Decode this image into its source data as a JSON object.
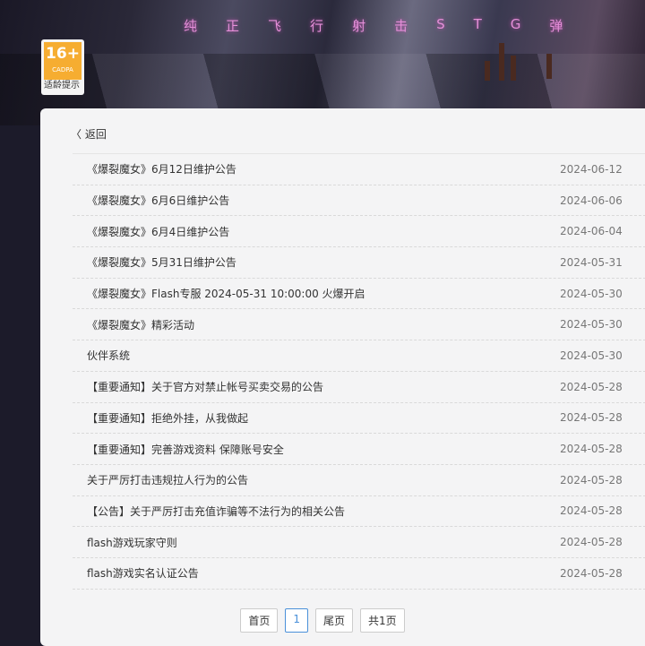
{
  "banner": {
    "slogan": [
      "纯",
      "正",
      "飞",
      "行",
      "射",
      "击",
      "S",
      "T",
      "G",
      "弹"
    ]
  },
  "age_badge": {
    "rating": "16+",
    "org": "CADPA",
    "label": "适龄提示"
  },
  "back_label": "〈 返回",
  "notices": [
    {
      "title": "《爆裂魔女》6月12日维护公告",
      "date": "2024-06-12"
    },
    {
      "title": "《爆裂魔女》6月6日维护公告",
      "date": "2024-06-06"
    },
    {
      "title": "《爆裂魔女》6月4日维护公告",
      "date": "2024-06-04"
    },
    {
      "title": "《爆裂魔女》5月31日维护公告",
      "date": "2024-05-31"
    },
    {
      "title": "《爆裂魔女》Flash专服 2024-05-31 10:00:00 火爆开启",
      "date": "2024-05-30"
    },
    {
      "title": "《爆裂魔女》精彩活动",
      "date": "2024-05-30"
    },
    {
      "title": "伙伴系统",
      "date": "2024-05-30"
    },
    {
      "title": "【重要通知】关于官方对禁止帐号买卖交易的公告",
      "date": "2024-05-28"
    },
    {
      "title": "【重要通知】拒绝外挂，从我做起",
      "date": "2024-05-28"
    },
    {
      "title": "【重要通知】完善游戏资料 保障账号安全",
      "date": "2024-05-28"
    },
    {
      "title": "关于严厉打击违规拉人行为的公告",
      "date": "2024-05-28"
    },
    {
      "title": "【公告】关于严厉打击充值诈骗等不法行为的相关公告",
      "date": "2024-05-28"
    },
    {
      "title": "flash游戏玩家守则",
      "date": "2024-05-28"
    },
    {
      "title": "flash游戏实名认证公告",
      "date": "2024-05-28"
    }
  ],
  "pagination": {
    "first": "首页",
    "current": "1",
    "last": "尾页",
    "total": "共1页"
  }
}
